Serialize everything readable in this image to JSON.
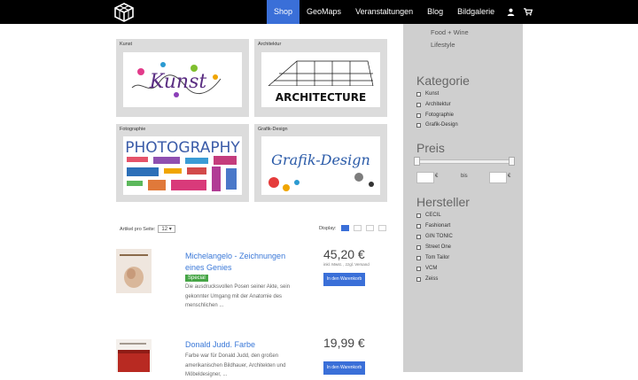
{
  "nav": {
    "items": [
      {
        "label": "Shop",
        "active": true
      },
      {
        "label": "GeoMaps",
        "active": false
      },
      {
        "label": "Veranstaltungen",
        "active": false
      },
      {
        "label": "Blog",
        "active": false
      },
      {
        "label": "Bildgalerie",
        "active": false
      }
    ],
    "icons": [
      "user-icon",
      "cart-icon"
    ]
  },
  "categories": [
    {
      "label": "Kunst",
      "image_text": "Kunst"
    },
    {
      "label": "Architektur",
      "image_text": "ARCHITECTURE"
    },
    {
      "label": "Fotographie",
      "image_text": "PHOTOGRAPHY"
    },
    {
      "label": "Grafik-Design",
      "image_text": "Grafik-Design"
    }
  ],
  "sidebar": {
    "links": [
      "Food + Wine",
      "Lifestyle"
    ],
    "kategorie_title": "Kategorie",
    "kategorie_items": [
      "Kunst",
      "Architektur",
      "Fotographie",
      "Grafik-Design"
    ],
    "preis_title": "Preis",
    "price_from_symbol": "€",
    "price_to_label": "bis",
    "price_to_symbol": "€",
    "hersteller_title": "Hersteller",
    "hersteller_items": [
      "CECIL",
      "Fashionart",
      "GIN TONIC",
      "Street One",
      "Tom Tailor",
      "VCM",
      "Zeiss"
    ]
  },
  "listing": {
    "per_page_label": "Artikel pro Seite:",
    "per_page_value": "12",
    "display_label": "Display:"
  },
  "products": [
    {
      "title": "Michelangelo - Zeichnungen eines Genies",
      "badge": "Special",
      "description": "Die ausdrucksvollen Posen seiner Akte, sein gekonnter Umgang mit der Anatomie des menschlichen ...",
      "price": "45,20 €",
      "vat": "inkl. Mwst. , zzgl. Versand",
      "button": "In den Warenkorb",
      "thumb_text": "MICHELANGELO"
    },
    {
      "title": "Donald Judd. Farbe",
      "badge": "",
      "description": "Farbe war für Donald Judd, den großen amerikanischen Bildhauer, Architekten und Möbeldesigner, ...",
      "price": "19,99 €",
      "vat": "",
      "button": "In den Warenkorb",
      "thumb_text": ""
    }
  ],
  "colors": {
    "accent": "#3a6fd8",
    "topbar": "#000000",
    "sidebar": "#cfcfcf",
    "special": "#46a546",
    "link": "#3a78d8"
  }
}
